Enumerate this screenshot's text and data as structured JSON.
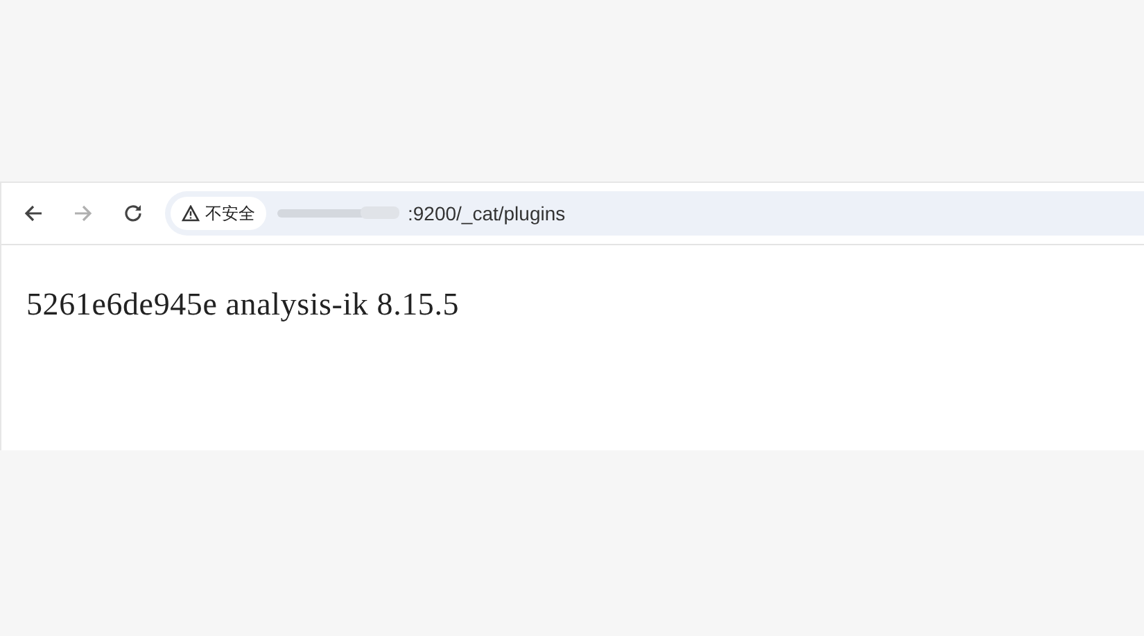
{
  "toolbar": {
    "back": {
      "disabled": false
    },
    "forward": {
      "disabled": true
    },
    "security_label": "不安全",
    "url": ":9200/_cat/plugins"
  },
  "page": {
    "text": "5261e6de945e analysis-ik 8.15.5"
  }
}
